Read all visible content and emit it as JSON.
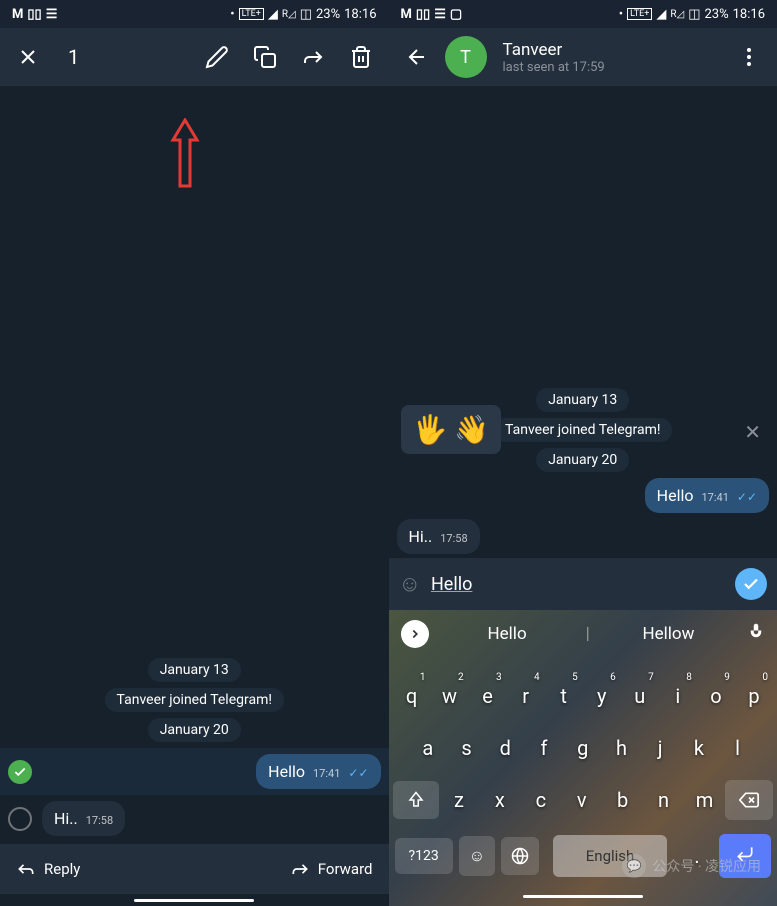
{
  "status_bar": {
    "left_icons": "M",
    "time": "18:16",
    "battery": "23%",
    "network": "LTE+"
  },
  "left_screen": {
    "selection_count": "1",
    "chat": {
      "date1": "January 13",
      "system_msg": "Tanveer joined Telegram!",
      "date2": "January 20",
      "msg_out_text": "Hello",
      "msg_out_time": "17:41",
      "msg_in_text": "Hi..",
      "msg_in_time": "17:58"
    },
    "bottom": {
      "reply": "Reply",
      "forward": "Forward"
    }
  },
  "right_screen": {
    "contact": {
      "avatar_letter": "T",
      "name": "Tanveer",
      "status": "last seen at 17:59"
    },
    "chat": {
      "date1": "January 13",
      "system_msg": "Tanveer joined Telegram!",
      "date2": "January 20",
      "msg_out_text": "Hello",
      "msg_out_time": "17:41",
      "msg_in_text": "Hi..",
      "msg_in_time": "17:58"
    },
    "emoji_suggest": "🖐 👋",
    "input_value": "Hello",
    "keyboard": {
      "suggestion1": "Hello",
      "suggestion2": "Hellow",
      "row1": [
        "q",
        "w",
        "e",
        "r",
        "t",
        "y",
        "u",
        "i",
        "o",
        "p"
      ],
      "row1_nums": [
        "1",
        "2",
        "3",
        "4",
        "5",
        "6",
        "7",
        "8",
        "9",
        "0"
      ],
      "row2": [
        "a",
        "s",
        "d",
        "f",
        "g",
        "h",
        "j",
        "k",
        "l"
      ],
      "row3": [
        "z",
        "x",
        "c",
        "v",
        "b",
        "n",
        "m"
      ],
      "symbols_key": "?123",
      "space_label": "English"
    }
  },
  "watermark": "公众号 · 凌锐应用"
}
